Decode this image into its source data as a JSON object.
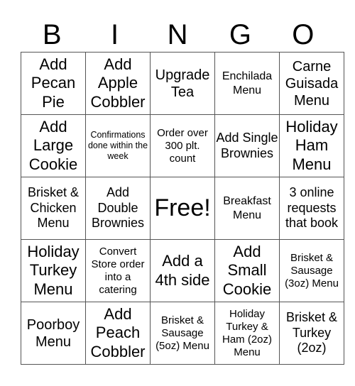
{
  "header": [
    "B",
    "I",
    "N",
    "G",
    "O"
  ],
  "grid": [
    [
      "Add Pecan Pie",
      "Add Apple Cobbler",
      "Upgrade Tea",
      "Enchilada Menu",
      "Carne Guisada Menu"
    ],
    [
      "Add Large Cookie",
      "Confirmations done within the week",
      "Order over 300 plt. count",
      "Add Single Brownies",
      "Holiday Ham Menu"
    ],
    [
      "Brisket & Chicken Menu",
      "Add Double Brownies",
      "Free!",
      "Breakfast Menu",
      "3 online requests that book"
    ],
    [
      "Holiday Turkey Menu",
      "Convert Store order into a catering",
      "Add a 4th side",
      "Add Small Cookie",
      "Brisket & Sausage (3oz) Menu"
    ],
    [
      "Poorboy Menu",
      "Add Peach Cobbler",
      "Brisket & Sausage (5oz) Menu",
      "Holiday Turkey & Ham (2oz) Menu",
      "Brisket & Turkey (2oz)"
    ]
  ]
}
